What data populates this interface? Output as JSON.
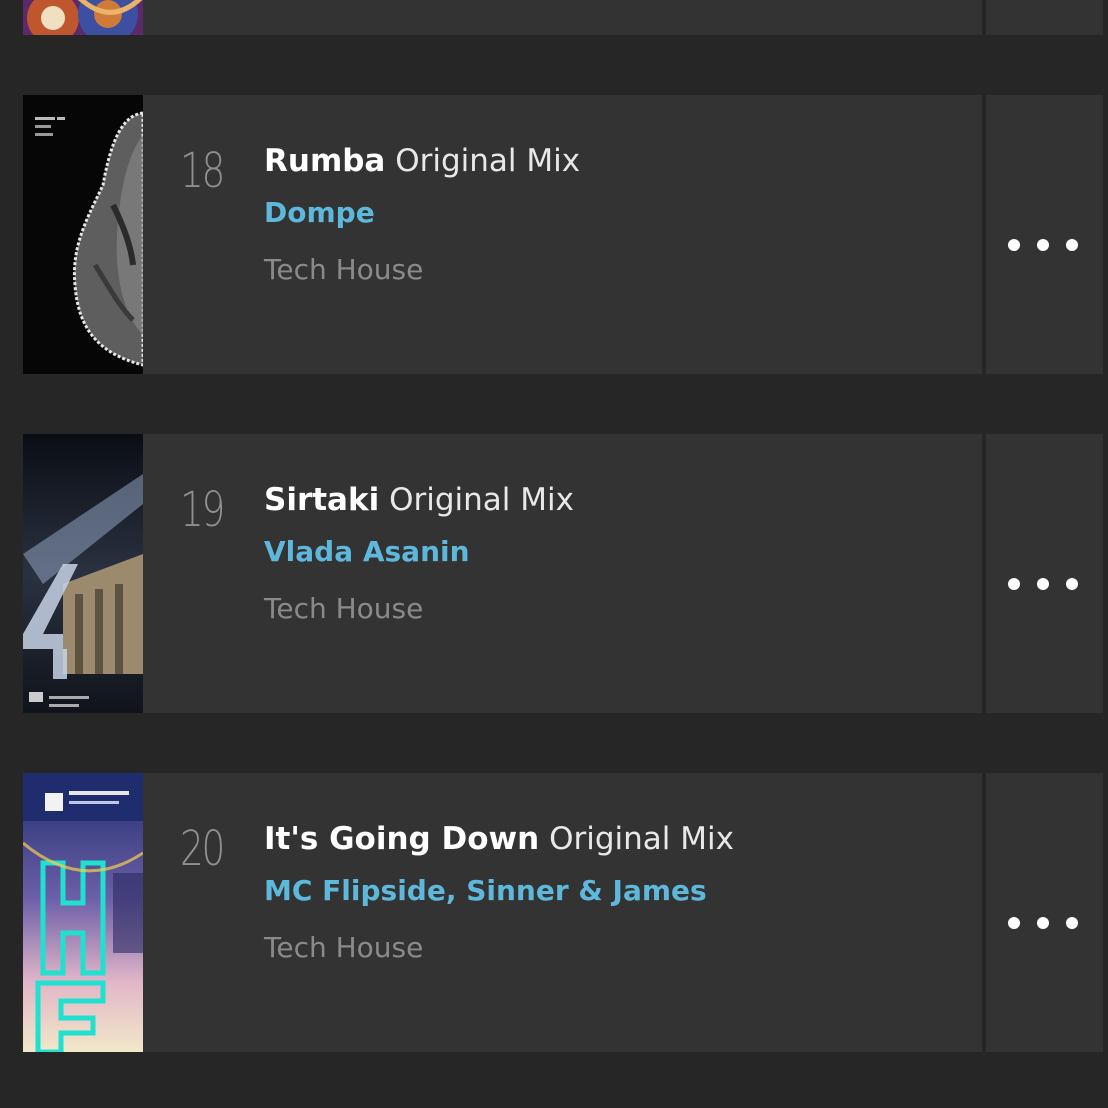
{
  "tracks": [
    {
      "rank": "18",
      "title": "Rumba",
      "mix": "Original Mix",
      "artists": "Dompe",
      "genre": "Tech House",
      "menu_icon": "more-horizontal-icon"
    },
    {
      "rank": "19",
      "title": "Sirtaki",
      "mix": "Original Mix",
      "artists": "Vlada Asanin",
      "genre": "Tech House",
      "menu_icon": "more-horizontal-icon"
    },
    {
      "rank": "20",
      "title": "It's Going Down",
      "mix": "Original Mix",
      "artists": "MC Flipside, Sinner & James",
      "genre": "Tech House",
      "menu_icon": "more-horizontal-icon"
    }
  ],
  "colors": {
    "background": "#262626",
    "card": "#333333",
    "artist_link": "#5db8dc",
    "genre_text": "#8a8a8a",
    "rank_text": "#8f8f8f"
  }
}
